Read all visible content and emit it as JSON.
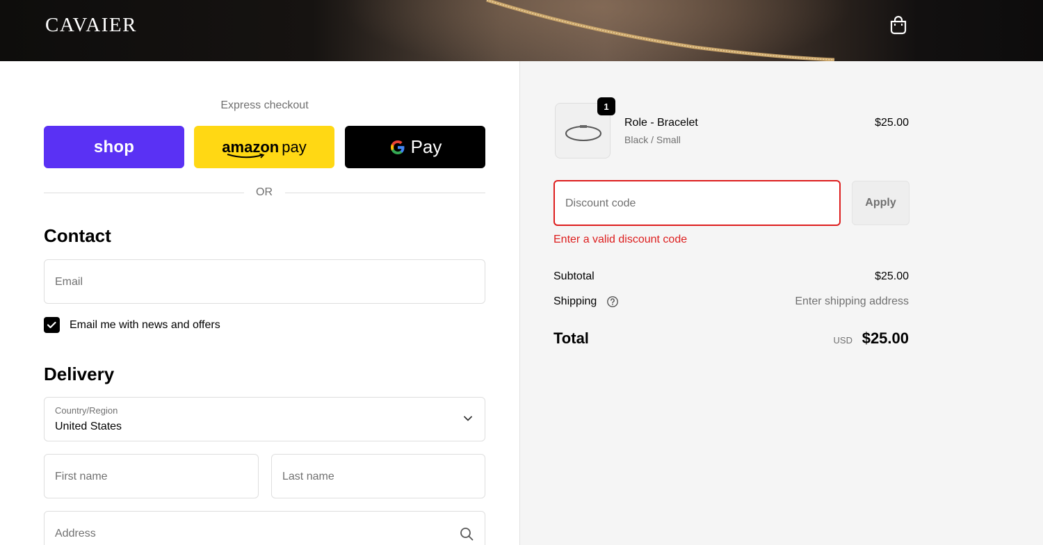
{
  "header": {
    "logo": "CAVAIER",
    "cart_icon": "shopping-bag-icon"
  },
  "express": {
    "title": "Express checkout",
    "shop_label": "shop",
    "amazon_label": "amazon",
    "amazon_pay_label": "pay",
    "gpay_label": "Pay",
    "or_label": "OR"
  },
  "contact": {
    "title": "Contact",
    "email_placeholder": "Email",
    "newsletter_label": "Email me with news and offers",
    "newsletter_checked": true
  },
  "delivery": {
    "title": "Delivery",
    "country_label": "Country/Region",
    "country_value": "United States",
    "first_name_placeholder": "First name",
    "last_name_placeholder": "Last name",
    "address_placeholder": "Address"
  },
  "order": {
    "quantity": "1",
    "item_name": "Role - Bracelet",
    "item_variant": "Black / Small",
    "item_price": "$25.00",
    "discount_placeholder": "Discount code",
    "apply_label": "Apply",
    "discount_error": "Enter a valid discount code",
    "subtotal_label": "Subtotal",
    "subtotal_value": "$25.00",
    "shipping_label": "Shipping",
    "shipping_value": "Enter shipping address",
    "total_label": "Total",
    "currency": "USD",
    "total_value": "$25.00"
  },
  "colors": {
    "shop_brand": "#5a31f4",
    "amazon_brand": "#ffd814",
    "error": "#dd1d1d",
    "muted_text": "#707070"
  }
}
